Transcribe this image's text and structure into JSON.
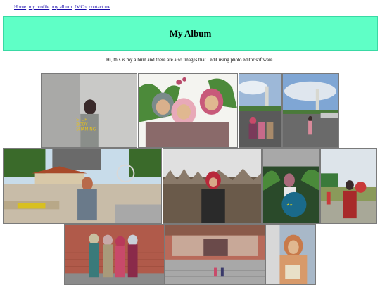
{
  "nav": {
    "links": [
      "Home",
      "my profile",
      "my album",
      "IMCo",
      "contact me"
    ]
  },
  "header": {
    "title": "My Album"
  },
  "intro": {
    "text": "Hi, this is my album and there are also images that I edit using photo editor software."
  },
  "photos": [
    {
      "name": "photo-wall-portrait",
      "caption": "STOP BODY SHAMING"
    },
    {
      "name": "photo-selfie-group"
    },
    {
      "name": "photo-tower-group"
    },
    {
      "name": "photo-tower-road"
    },
    {
      "name": "photo-park-playground"
    },
    {
      "name": "photo-grass-field"
    },
    {
      "name": "photo-garden-sign"
    },
    {
      "name": "photo-balloon-field"
    },
    {
      "name": "photo-brick-wall-group"
    },
    {
      "name": "photo-building-stairs"
    },
    {
      "name": "photo-book-portrait"
    }
  ],
  "colors": {
    "banner": "#5fffc6",
    "link": "#1a0dab"
  }
}
